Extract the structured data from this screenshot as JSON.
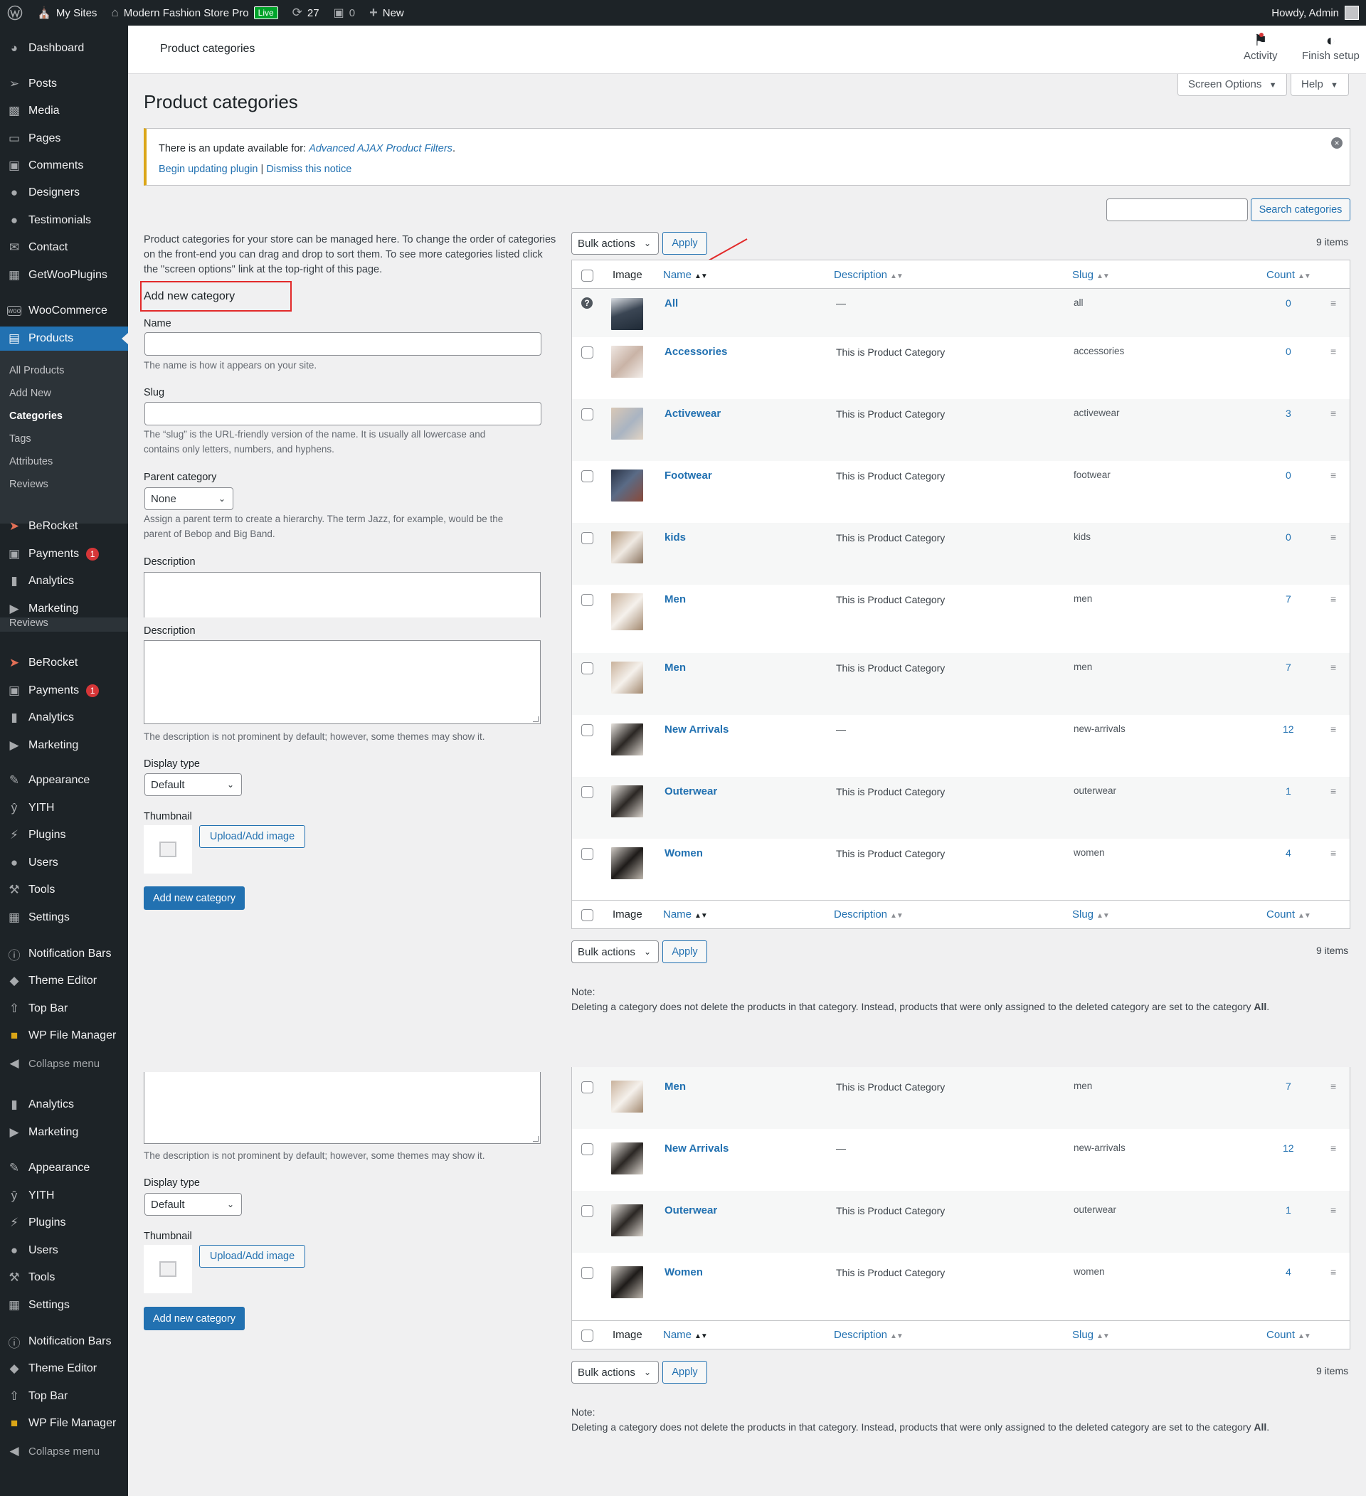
{
  "adminbar": {
    "my_sites": "My Sites",
    "site_name": "Modern Fashion Store Pro",
    "live": "Live",
    "updates": "27",
    "comments": "0",
    "new": "New",
    "howdy": "Howdy, Admin"
  },
  "sidebar": {
    "dashboard": "Dashboard",
    "posts": "Posts",
    "media": "Media",
    "pages": "Pages",
    "comments": "Comments",
    "designers": "Designers",
    "testimonials": "Testimonials",
    "contact": "Contact",
    "getwooplugins": "GetWooPlugins",
    "woocommerce": "WooCommerce",
    "products": "Products",
    "sub": {
      "all_products": "All Products",
      "add_new": "Add New",
      "categories": "Categories",
      "tags": "Tags",
      "attributes": "Attributes",
      "reviews": "Reviews"
    },
    "berocket": "BeRocket",
    "payments": "Payments",
    "payments_badge": "1",
    "analytics": "Analytics",
    "marketing": "Marketing",
    "appearance": "Appearance",
    "yith": "YITH",
    "plugins": "Plugins",
    "users": "Users",
    "tools": "Tools",
    "settings": "Settings",
    "notification_bars": "Notification Bars",
    "theme_editor": "Theme Editor",
    "top_bar": "Top Bar",
    "wp_file_manager": "WP File Manager",
    "collapse": "Collapse menu"
  },
  "header": {
    "title": "Product categories",
    "activity": "Activity",
    "finish_setup": "Finish setup",
    "screen_options": "Screen Options",
    "help": "Help"
  },
  "page_title": "Product categories",
  "notice": {
    "prefix": "There is an update available for: ",
    "plugin": "Advanced AJAX Product Filters",
    "suffix": ".",
    "begin": "Begin updating plugin",
    "sep": " | ",
    "dismiss": "Dismiss this notice"
  },
  "search": {
    "button": "Search categories"
  },
  "form": {
    "intro": [
      "Product categories for your store can be managed here. To change the order of categories",
      "on the front-end you can drag and drop to sort them. To see more categories listed click",
      "the \"screen options\" link at the top-right of this page."
    ],
    "heading": "Add new category",
    "name_label": "Name",
    "name_help": "The name is how it appears on your site.",
    "slug_label": "Slug",
    "slug_help": [
      "The “slug” is the URL-friendly version of the name. It is usually all lowercase and",
      "contains only letters, numbers, and hyphens."
    ],
    "parent_label": "Parent category",
    "parent_value": "None",
    "parent_help": [
      "Assign a parent term to create a hierarchy. The term Jazz, for example, would be the",
      "parent of Bebop and Big Band."
    ],
    "description_label": "Description",
    "description_help": "The description is not prominent by default; however, some themes may show it.",
    "display_type_label": "Display type",
    "display_type_value": "Default",
    "thumbnail_label": "Thumbnail",
    "upload_button": "Upload/Add image",
    "submit": "Add new category"
  },
  "table": {
    "bulk_actions": "Bulk actions",
    "apply": "Apply",
    "items": "9 items",
    "columns": {
      "image": "Image",
      "name": "Name",
      "description": "Description",
      "slug": "Slug",
      "count": "Count"
    },
    "rows": [
      {
        "name": "All",
        "description": "—",
        "slug": "all",
        "count": "0"
      },
      {
        "name": "Accessories",
        "description": "This is Product Category",
        "slug": "accessories",
        "count": "0"
      },
      {
        "name": "Activewear",
        "description": "This is Product Category",
        "slug": "activewear",
        "count": "3"
      },
      {
        "name": "Footwear",
        "description": "This is Product Category",
        "slug": "footwear",
        "count": "0"
      },
      {
        "name": "kids",
        "description": "This is Product Category",
        "slug": "kids",
        "count": "0"
      },
      {
        "name": "Men",
        "description": "This is Product Category",
        "slug": "men",
        "count": "7"
      },
      {
        "name": "Men",
        "description": "This is Product Category",
        "slug": "men",
        "count": "7"
      },
      {
        "name": "New Arrivals",
        "description": "—",
        "slug": "new-arrivals",
        "count": "12"
      },
      {
        "name": "Outerwear",
        "description": "This is Product Category",
        "slug": "outerwear",
        "count": "1"
      },
      {
        "name": "Women",
        "description": "This is Product Category",
        "slug": "women",
        "count": "4"
      }
    ],
    "note_title": "Note:",
    "note_body": "Deleting a category does not delete the products in that category. Instead, products that were only assigned to the deleted category are set to the category ",
    "note_bold": "All",
    "note_end": "."
  },
  "colors": {
    "accent": "#2271b1",
    "sidebar": "#1d2327",
    "highlight": "#e22a2a",
    "notice_border": "#dba617"
  }
}
